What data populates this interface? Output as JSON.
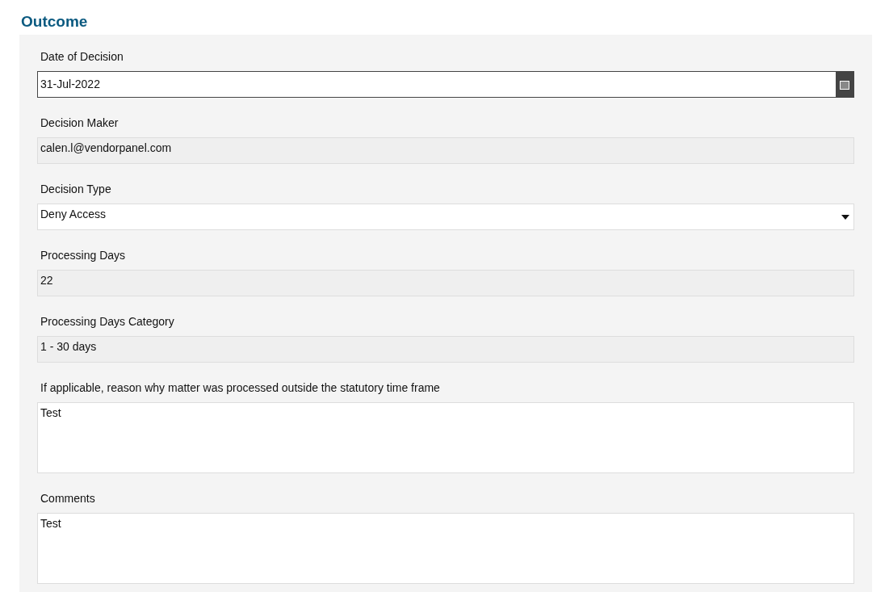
{
  "section": {
    "title": "Outcome"
  },
  "fields": [
    {
      "kind": "date",
      "label": "Date of Decision",
      "value": "31-Jul-2022"
    },
    {
      "kind": "readonly",
      "label": "Decision Maker",
      "value": "calen.l@vendorpanel.com"
    },
    {
      "kind": "select",
      "label": "Decision Type",
      "value": "Deny Access"
    },
    {
      "kind": "readonly",
      "label": "Processing Days",
      "value": "22"
    },
    {
      "kind": "readonly",
      "label": "Processing Days Category",
      "value": "1 - 30 days"
    },
    {
      "kind": "textarea",
      "label": "If applicable, reason why matter was processed outside the statutory time frame",
      "value": "Test"
    },
    {
      "kind": "textarea",
      "label": "Comments",
      "value": "Test"
    }
  ]
}
